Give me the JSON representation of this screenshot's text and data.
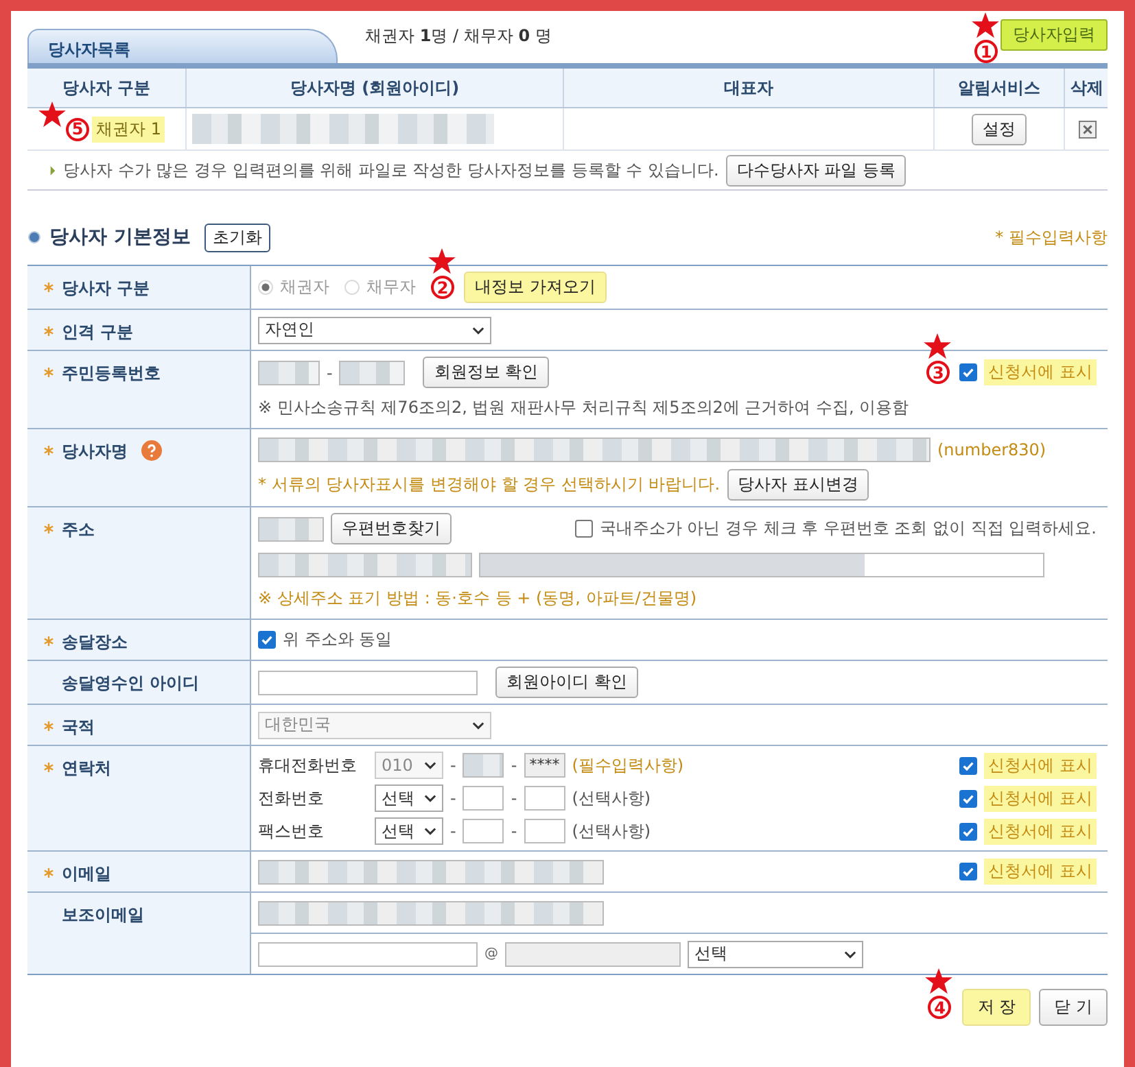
{
  "list": {
    "tab": "당사자목록",
    "summary": "채권자 **1**명 / 채무자 **0** 명",
    "add_button": {
      "label": "당사자입력",
      "annotation": "1"
    },
    "columns": [
      "당사자 구분",
      "당사자명 (회원아이디)",
      "대표자",
      "알림서비스",
      "삭제"
    ],
    "rows": [
      {
        "type": "채권자 1",
        "highlighted": true,
        "annotation": "5",
        "notify_button": "설정"
      }
    ],
    "note": "당사자 수가 많은 경우 입력편의를 위해 파일로 작성한 당사자정보를 등록할 수 있습니다.",
    "file_button": "다수당사자 파일 등록"
  },
  "form": {
    "title": "당사자 기본정보",
    "reset_button": "초기화",
    "required_note": "* 필수입력사항",
    "rows": [
      {
        "kind": "party_type",
        "label": "당사자 구분",
        "required": true,
        "disabled": true,
        "radios": [
          {
            "label": "채권자",
            "selected": true
          },
          {
            "label": "채무자",
            "selected": false
          }
        ],
        "annotation": "2",
        "import_button": "내정보 가져오기"
      },
      {
        "kind": "person_type",
        "label": "인격 구분",
        "required": true,
        "select": "자연인"
      },
      {
        "kind": "resident_no",
        "label": "주민등록번호",
        "required": true,
        "dash": "-",
        "button": "회원정보 확인",
        "display": {
          "label": "신청서에 표시",
          "checked": true,
          "highlighted": true,
          "annotation": "3"
        },
        "note": "※ 민사소송규칙 제76조의2, 법원 재판사무 처리규칙 제5조의2에 근거하여 수집, 이용함"
      },
      {
        "kind": "name",
        "label": "당사자명",
        "required": true,
        "help": true,
        "member_id": "(number830)",
        "note": "* 서류의 당사자표시를 변경해야 할 경우 선택하시기 바랍니다.",
        "button": "당사자 표시변경"
      },
      {
        "kind": "address",
        "label": "주소",
        "required": true,
        "button": "우편번호찾기",
        "foreign": {
          "label": "국내주소가 아닌 경우 체크 후 우편번호 조회 없이 직접 입력하세요.",
          "checked": false
        },
        "note": "※ 상세주소 표기 방법 : 동·호수 등 + (동명, 아파트/건물명)"
      },
      {
        "kind": "delivery",
        "label": "송달장소",
        "required": true,
        "same": {
          "label": "위 주소와 동일",
          "checked": true
        }
      },
      {
        "kind": "recipient",
        "label": "송달영수인 아이디",
        "required": false,
        "button": "회원아이디 확인"
      },
      {
        "kind": "nationality",
        "label": "국적",
        "required": true,
        "disabled": true,
        "select": "대한민국"
      },
      {
        "kind": "contact",
        "label": "연락처",
        "required": true,
        "lines": [
          {
            "label": "휴대전화번호",
            "dashes": [
              "-",
              "-"
            ],
            "select": "010",
            "disabled": true,
            "last": "****",
            "hint": "(필수입력사항)",
            "required": true,
            "display": {
              "label": "신청서에 표시",
              "checked": true,
              "highlighted": true
            }
          },
          {
            "label": "전화번호",
            "dashes": [
              "-",
              "-"
            ],
            "select": "선택",
            "disabled": false,
            "hint": "(선택사항)",
            "required": false,
            "display": {
              "label": "신청서에 표시",
              "checked": true,
              "highlighted": true
            }
          },
          {
            "label": "팩스번호",
            "dashes": [
              "-",
              "-"
            ],
            "select": "선택",
            "disabled": false,
            "hint": "(선택사항)",
            "required": false,
            "display": {
              "label": "신청서에 표시",
              "checked": true,
              "highlighted": true
            }
          }
        ]
      },
      {
        "kind": "email",
        "label": "이메일",
        "required": true,
        "display": {
          "label": "신청서에 표시",
          "checked": true,
          "highlighted": true
        }
      },
      {
        "kind": "sub_email",
        "label": "보조이메일",
        "required": false,
        "at": "@",
        "select": "선택"
      }
    ]
  },
  "buttons": [
    {
      "label": "저 장",
      "highlighted": true,
      "annotation": "4"
    },
    {
      "label": "닫 기",
      "highlighted": false
    }
  ]
}
